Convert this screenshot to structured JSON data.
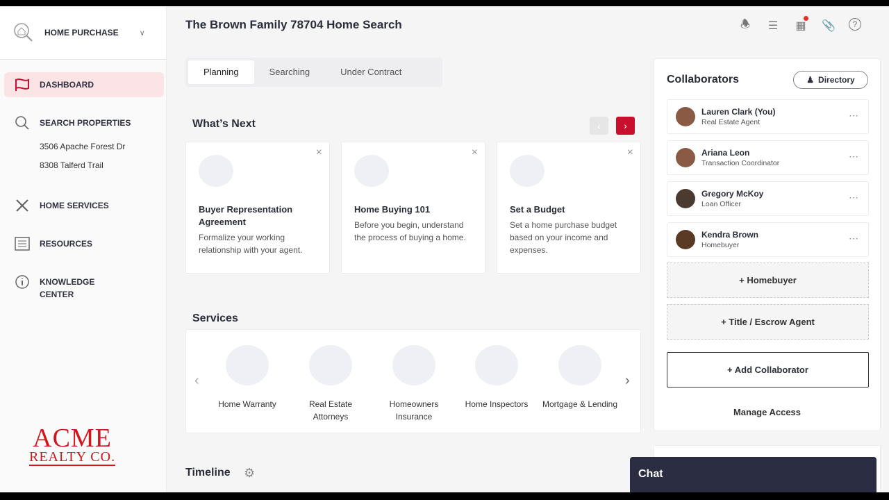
{
  "sidebar": {
    "workspace": "HOME PURCHASE",
    "items": [
      {
        "label": "DASHBOARD"
      },
      {
        "label": "SEARCH PROPERTIES"
      },
      {
        "label": "HOME SERVICES"
      },
      {
        "label": "RESOURCES"
      },
      {
        "label": "KNOWLEDGE CENTER"
      }
    ],
    "properties": [
      "3506 Apache Forest Dr",
      "8308 Talferd Trail"
    ],
    "logo": {
      "line1": "ACME",
      "line2": "REALTY CO."
    }
  },
  "header": {
    "title": "The Brown Family 78704 Home Search"
  },
  "tabs": [
    "Planning",
    "Searching",
    "Under Contract"
  ],
  "whats_next": {
    "title": "What’s Next",
    "cards": [
      {
        "title": "Buyer Representation Agreement",
        "desc": "Formalize your working relationship with your agent."
      },
      {
        "title": "Home Buying 101",
        "desc": "Before you begin, understand the process of buying a home."
      },
      {
        "title": "Set a Budget",
        "desc": "Set a home purchase budget based on your income and expenses."
      }
    ]
  },
  "services": {
    "title": "Services",
    "items": [
      "Home Warranty",
      "Real Estate Attorneys",
      "Homeowners Insurance",
      "Home Inspectors",
      "Mortgage & Lending"
    ]
  },
  "timeline": {
    "title": "Timeline"
  },
  "collaborators": {
    "title": "Collaborators",
    "directory": "Directory",
    "people": [
      {
        "name": "Lauren Clark (You)",
        "role": "Real Estate Agent"
      },
      {
        "name": "Ariana Leon",
        "role": "Transaction Coordinator"
      },
      {
        "name": "Gregory McKoy",
        "role": "Loan Officer"
      },
      {
        "name": "Kendra Brown",
        "role": "Homebuyer"
      }
    ],
    "add_homebuyer": "+  Homebuyer",
    "add_title": "+  Title / Escrow Agent",
    "add_collaborator": "+  Add Collaborator",
    "manage": "Manage Access"
  },
  "chat": {
    "label": "Chat"
  },
  "colors": {
    "accent": "#c8102e"
  }
}
